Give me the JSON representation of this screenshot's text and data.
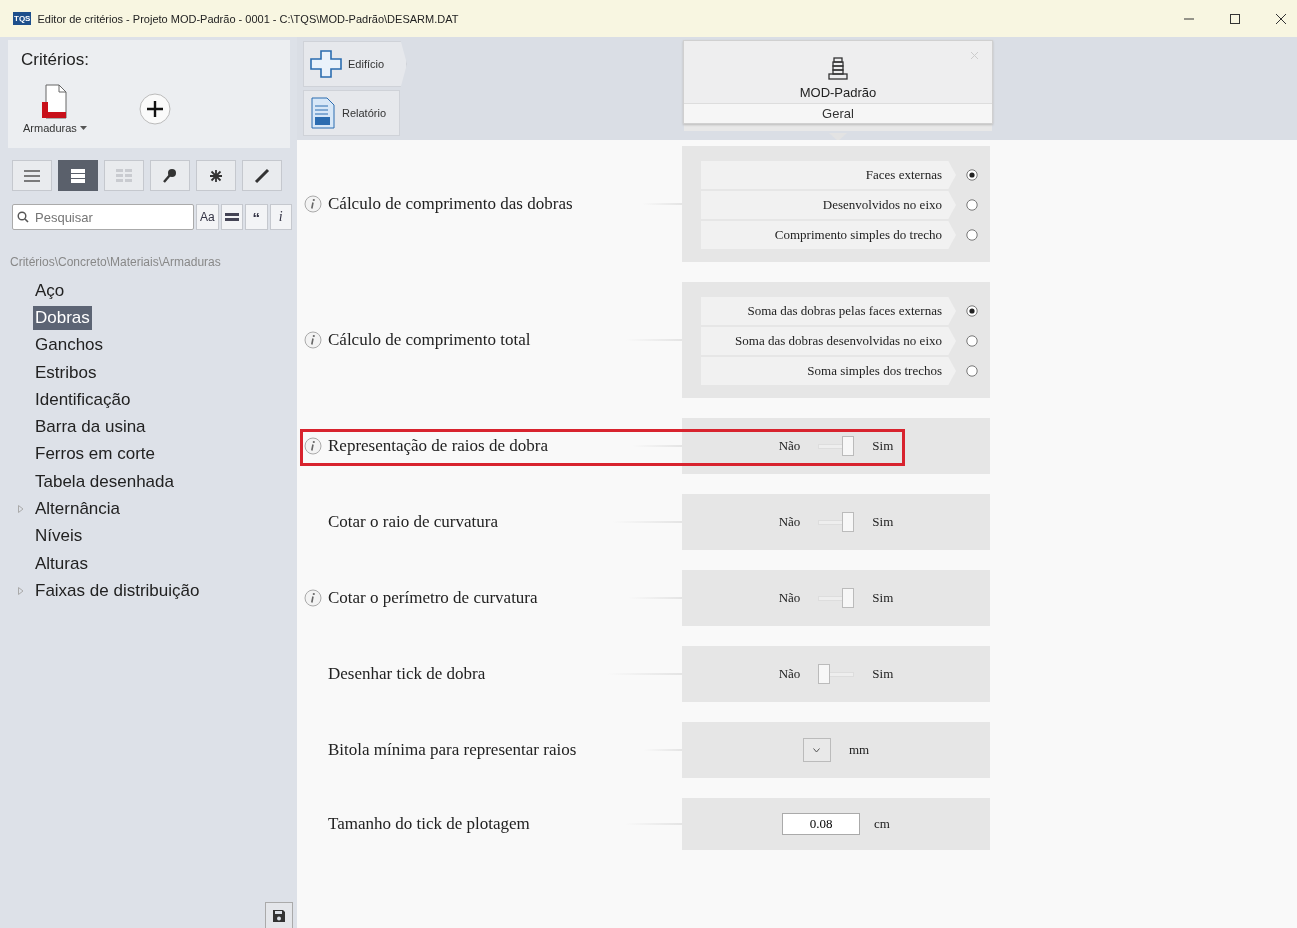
{
  "window": {
    "title": "Editor de critérios - Projeto MOD-Padrão - 0001 - C:\\TQS\\MOD-Padrão\\DESARM.DAT",
    "app_badge": "TQS"
  },
  "sidebar": {
    "heading": "Critérios:",
    "category": "Armaduras",
    "toolbar": [
      {
        "kind": "list",
        "selected": false
      },
      {
        "kind": "detail",
        "selected": true
      },
      {
        "kind": "grid",
        "selected": false
      },
      {
        "kind": "key",
        "selected": false
      },
      {
        "kind": "star",
        "selected": false
      },
      {
        "kind": "pencil",
        "selected": false
      }
    ],
    "search": {
      "placeholder": "Pesquisar",
      "options": [
        "Aa",
        "“",
        "i"
      ]
    },
    "path": "Critérios\\Concreto\\Materiais\\Armaduras",
    "tree": [
      {
        "label": "Aço",
        "selected": false,
        "kind": "leaf"
      },
      {
        "label": "Dobras",
        "selected": true,
        "kind": "leaf"
      },
      {
        "label": "Ganchos",
        "selected": false,
        "kind": "leaf"
      },
      {
        "label": "Estribos",
        "selected": false,
        "kind": "leaf"
      },
      {
        "label": "Identificação",
        "selected": false,
        "kind": "leaf"
      },
      {
        "label": "Barra da usina",
        "selected": false,
        "kind": "leaf"
      },
      {
        "label": "Ferros em corte",
        "selected": false,
        "kind": "leaf"
      },
      {
        "label": "Tabela desenhada",
        "selected": false,
        "kind": "leaf"
      },
      {
        "label": "Alternância",
        "selected": false,
        "kind": "group"
      },
      {
        "label": "Níveis",
        "selected": false,
        "kind": "leaf"
      },
      {
        "label": "Alturas",
        "selected": false,
        "kind": "leaf"
      },
      {
        "label": "Faixas de distribuição",
        "selected": false,
        "kind": "group"
      }
    ]
  },
  "nav": [
    {
      "label": "Edifício",
      "kind": "building"
    },
    {
      "label": "Relatório",
      "kind": "report"
    }
  ],
  "project_card": {
    "name": "MOD-Padrão",
    "tab": "Geral"
  },
  "settings": [
    {
      "kind": "radio",
      "label": "Cálculo de comprimento das dobras",
      "info": true,
      "highlighted": false,
      "options": [
        {
          "label": "Faces externas",
          "selected": true
        },
        {
          "label": "Desenvolvidos no eixo",
          "selected": false
        },
        {
          "label": "Comprimento simples do trecho",
          "selected": false
        }
      ]
    },
    {
      "kind": "radio",
      "label": "Cálculo de comprimento total",
      "info": true,
      "highlighted": false,
      "options": [
        {
          "label": "Soma das dobras pelas faces externas",
          "selected": true
        },
        {
          "label": "Soma das dobras desenvolvidas no eixo",
          "selected": false
        },
        {
          "label": "Soma simples dos trechos",
          "selected": false
        }
      ]
    },
    {
      "kind": "toggle",
      "label": "Representação de raios de dobra",
      "info": true,
      "highlighted": true,
      "off_label": "Não",
      "on_label": "Sim",
      "on": true
    },
    {
      "kind": "toggle",
      "label": "Cotar o raio de curvatura",
      "info": false,
      "highlighted": false,
      "off_label": "Não",
      "on_label": "Sim",
      "on": true
    },
    {
      "kind": "toggle",
      "label": "Cotar o perímetro de curvatura",
      "info": true,
      "highlighted": false,
      "off_label": "Não",
      "on_label": "Sim",
      "on": true
    },
    {
      "kind": "toggle",
      "label": "Desenhar tick de dobra",
      "info": false,
      "highlighted": false,
      "off_label": "Não",
      "on_label": "Sim",
      "on": false
    },
    {
      "kind": "dropdown",
      "label": "Bitola mínima para representar raios",
      "info": false,
      "highlighted": false,
      "unit": "mm"
    },
    {
      "kind": "number",
      "label": "Tamanho do tick de plotagem",
      "info": false,
      "highlighted": false,
      "value": "0.08",
      "unit": "cm"
    }
  ]
}
